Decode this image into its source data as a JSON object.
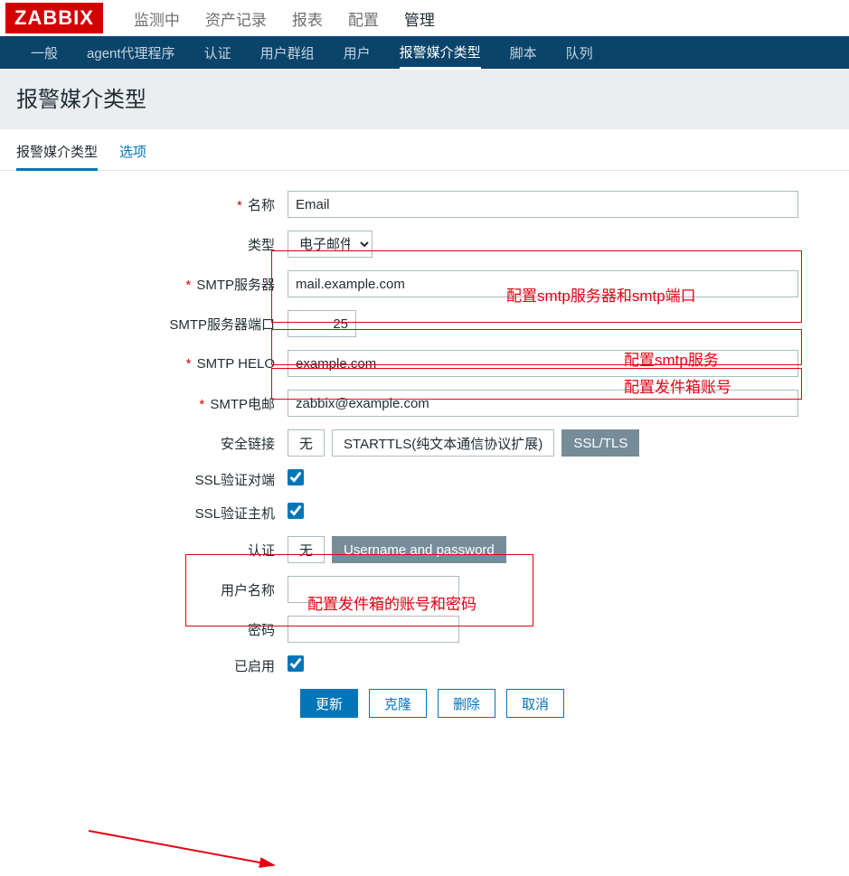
{
  "topnav": {
    "logo": "ZABBIX",
    "items": [
      "监测中",
      "资产记录",
      "报表",
      "配置",
      "管理"
    ],
    "active": 4
  },
  "subnav": {
    "items": [
      "一般",
      "agent代理程序",
      "认证",
      "用户群组",
      "用户",
      "报警媒介类型",
      "脚本",
      "队列"
    ],
    "active": 5
  },
  "header": {
    "title": "报警媒介类型"
  },
  "tabs": {
    "items": [
      "报警媒介类型",
      "选项"
    ],
    "active": 0
  },
  "form": {
    "name_label": "名称",
    "name_value": "Email",
    "type_label": "类型",
    "type_value": "电子邮件",
    "smtp_server_label": "SMTP服务器",
    "smtp_server_value": "mail.example.com",
    "smtp_port_label": "SMTP服务器端口",
    "smtp_port_value": "25",
    "smtp_helo_label": "SMTP HELO",
    "smtp_helo_value": "example.com",
    "smtp_email_label": "SMTP电邮",
    "smtp_email_value": "zabbix@example.com",
    "security_label": "安全链接",
    "security_opts": [
      "无",
      "STARTTLS(纯文本通信协议扩展)",
      "SSL/TLS"
    ],
    "ssl_peer_label": "SSL验证对端",
    "ssl_host_label": "SSL验证主机",
    "auth_label": "认证",
    "auth_opts": [
      "无",
      "Username and password"
    ],
    "user_label": "用户名称",
    "user_value": "",
    "pass_label": "密码",
    "pass_value": "",
    "enabled_label": "已启用"
  },
  "actions": {
    "update": "更新",
    "clone": "克隆",
    "delete": "删除",
    "cancel": "取消"
  },
  "annotations": {
    "a1": "配置smtp服务器和smtp端口",
    "a2": "配置smtp服务",
    "a3": "配置发件箱账号",
    "a4": "配置发件箱的账号和密码"
  }
}
